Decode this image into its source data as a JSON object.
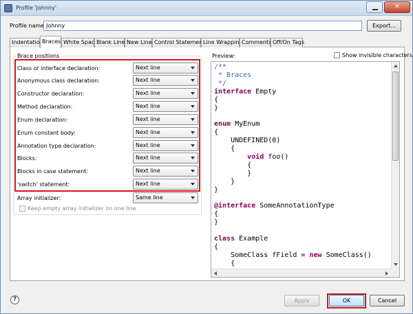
{
  "window": {
    "title": "Profile 'Johnny'",
    "close_glyph": "✕"
  },
  "profile": {
    "label": "Profile name:",
    "value": "Johnny",
    "export_label": "Export..."
  },
  "tabs": [
    "Indentation",
    "Braces",
    "White Space",
    "Blank Lines",
    "New Lines",
    "Control Statements",
    "Line Wrapping",
    "Comments",
    "Off/On Tags"
  ],
  "active_tab": "Braces",
  "brace_positions": {
    "group_title": "Brace positions",
    "options": [
      {
        "label": "Class or interface declaration:",
        "value": "Next line"
      },
      {
        "label": "Anonymous class declaration:",
        "value": "Next line"
      },
      {
        "label": "Constructor declaration:",
        "value": "Next line"
      },
      {
        "label": "Method declaration:",
        "value": "Next line"
      },
      {
        "label": "Enum declaration:",
        "value": "Next line"
      },
      {
        "label": "Enum constant body:",
        "value": "Next line"
      },
      {
        "label": "Annotation type declaration:",
        "value": "Next line"
      },
      {
        "label": "Blocks:",
        "value": "Next line"
      },
      {
        "label": "Blocks in case statement:",
        "value": "Next line"
      },
      {
        "label": "'switch' statement:",
        "value": "Next line"
      }
    ],
    "array_initializer": {
      "label": "Array initializer:",
      "value": "Same line"
    },
    "keep_empty": {
      "label": "Keep empty array initializer on one line",
      "checked": false
    }
  },
  "preview": {
    "label": "Preview:",
    "show_invisible_label": "Show invisible characters",
    "code_lines": [
      "/**",
      " * Braces",
      " */",
      "interface Empty",
      "{",
      "}",
      "",
      "enum MyEnum",
      "{",
      "    UNDEFINED(0)",
      "    {",
      "        void foo()",
      "        {",
      "        }",
      "    }",
      "}",
      "",
      "@interface SomeAnnotationType",
      "{",
      "}",
      "",
      "class Example",
      "{",
      "    SomeClass fField = new SomeClass()",
      "    {"
    ]
  },
  "footer": {
    "help_glyph": "?",
    "apply_label": "Apply",
    "ok_label": "OK",
    "cancel_label": "Cancel"
  },
  "colors": {
    "highlight": "#d8141b",
    "keyword": "#7f0055",
    "comment": "#3f5fbf"
  }
}
